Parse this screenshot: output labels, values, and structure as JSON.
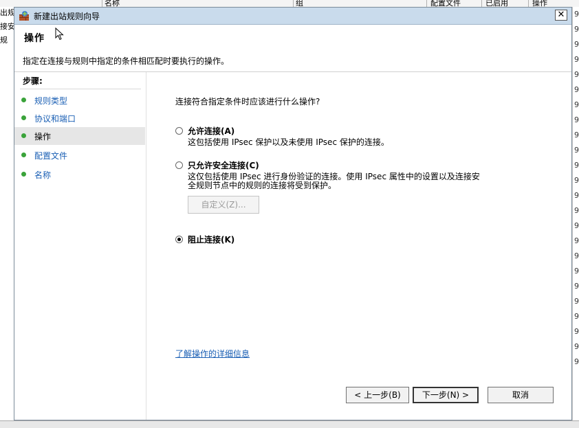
{
  "background": {
    "header_columns": [
      "名称",
      "组",
      "配置文件",
      "已启用",
      "操作"
    ],
    "left_fragments": [
      "出规",
      "接安",
      "规"
    ],
    "right_digits": [
      "9",
      "9",
      "9",
      "9",
      "9",
      "9",
      "9",
      "9",
      "9",
      "9",
      "9",
      "9",
      "9",
      "9",
      "9",
      "9",
      "9",
      "9",
      "9",
      "9",
      "9",
      "9",
      "9",
      "9"
    ]
  },
  "window": {
    "title": "新建出站规则向导",
    "close_label": "✕"
  },
  "header": {
    "heading": "操作",
    "description": "指定在连接与规则中指定的条件相匹配时要执行的操作。"
  },
  "steps": {
    "title": "步骤:",
    "items": [
      {
        "label": "规则类型",
        "current": false
      },
      {
        "label": "协议和端口",
        "current": false
      },
      {
        "label": "操作",
        "current": true
      },
      {
        "label": "配置文件",
        "current": false
      },
      {
        "label": "名称",
        "current": false
      }
    ]
  },
  "content": {
    "question": "连接符合指定条件时应该进行什么操作?",
    "options": [
      {
        "label": "允许连接(A)",
        "description": "这包括使用 IPsec 保护以及未使用 IPsec 保护的连接。",
        "selected": false
      },
      {
        "label": "只允许安全连接(C)",
        "description_line1": "这仅包括使用 IPsec 进行身份验证的连接。使用 IPsec 属性中的设置以及连接安",
        "description_line2": "全规则节点中的规则的连接将受到保护。",
        "selected": false
      },
      {
        "label": "阻止连接(K)",
        "selected": true
      }
    ],
    "customize_label": "自定义(Z)...",
    "learn_more": "了解操作的详细信息"
  },
  "buttons": {
    "back": "< 上一步(B)",
    "next": "下一步(N) >",
    "cancel": "取消"
  }
}
